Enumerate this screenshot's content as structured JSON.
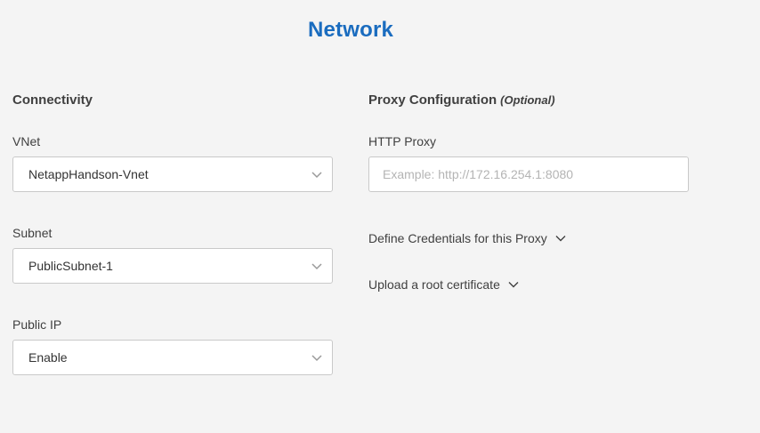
{
  "page": {
    "title": "Network"
  },
  "connectivity": {
    "heading": "Connectivity",
    "vnet": {
      "label": "VNet",
      "value": "NetappHandson-Vnet"
    },
    "subnet": {
      "label": "Subnet",
      "value": "PublicSubnet-1"
    },
    "public_ip": {
      "label": "Public IP",
      "value": "Enable"
    }
  },
  "proxy": {
    "heading": "Proxy Configuration",
    "optional_tag": "(Optional)",
    "http_proxy": {
      "label": "HTTP Proxy",
      "value": "",
      "placeholder": "Example: http://172.16.254.1:8080"
    },
    "define_credentials_label": "Define Credentials for this Proxy",
    "upload_certificate_label": "Upload a root certificate"
  },
  "icons": {
    "dropdown": "chevron-down-icon",
    "expander": "chevron-down-icon"
  },
  "colors": {
    "accent": "#1a6cbf",
    "background": "#f4f4f4",
    "text": "#404040",
    "border": "#c9c9c9",
    "placeholder": "#b4b4b4"
  }
}
